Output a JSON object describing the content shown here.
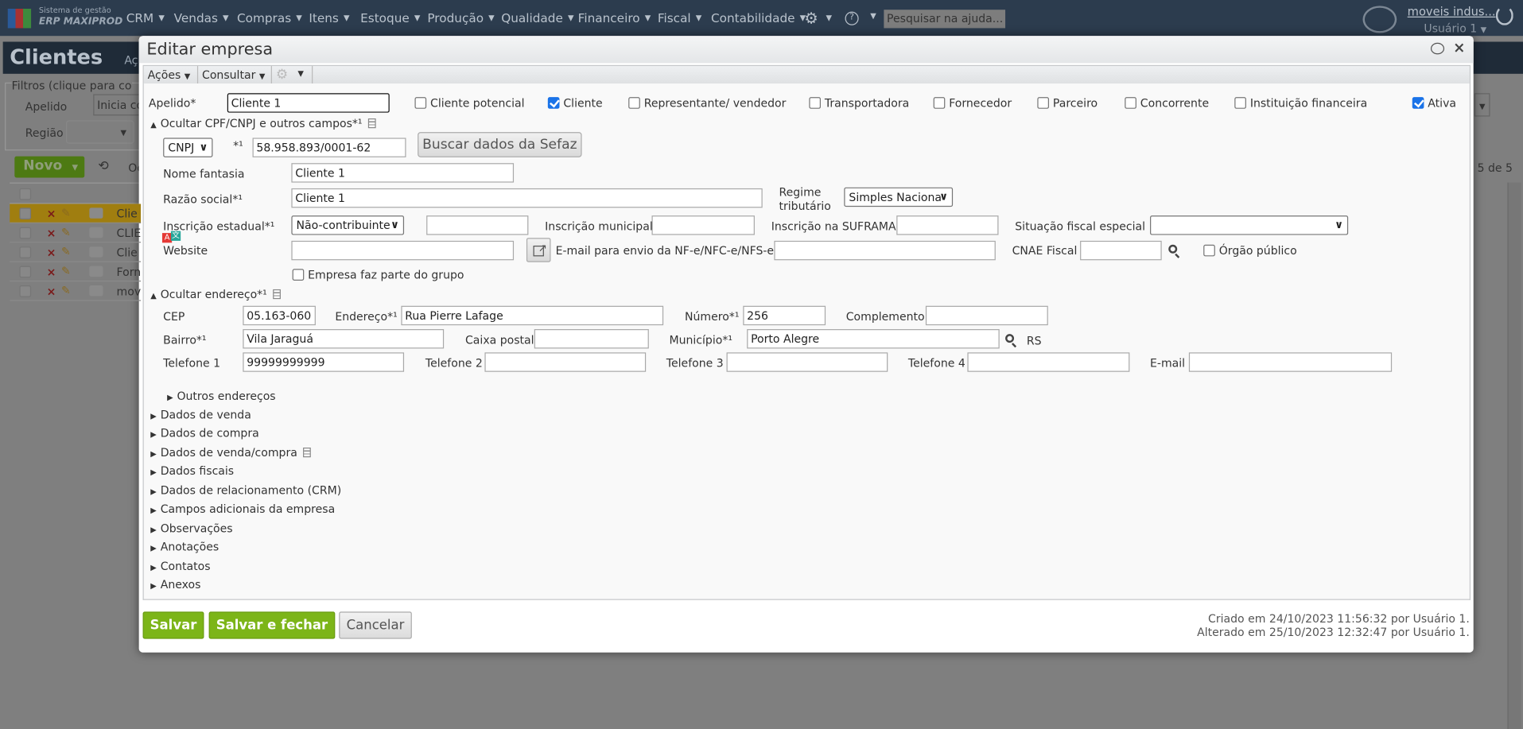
{
  "app": {
    "logo_line1": "Sistema de gestão",
    "logo_line2": "ERP MAXIPROD",
    "nav": [
      "CRM",
      "Vendas",
      "Compras",
      "Itens",
      "Estoque",
      "Produção",
      "Qualidade",
      "Financeiro",
      "Fiscal",
      "Contabilidade"
    ],
    "help_search_placeholder": "Pesquisar na ajuda...",
    "company": "moveis indus...",
    "user": "Usuário 1"
  },
  "background": {
    "page_title": "Clientes",
    "page_title_cut": "Aç",
    "filters_label": "Filtros (clique para co",
    "apelido_label": "Apelido",
    "apelido_value": "Inicia co",
    "regiao_label": "Região",
    "novo_label": "Novo",
    "order_cut": "Oc",
    "count": "5 de 5",
    "rows": [
      "Clie",
      "CLIE",
      "Clie",
      "Forn",
      "mov"
    ]
  },
  "modal": {
    "title": "Editar empresa",
    "toolbar": {
      "acoes": "Ações",
      "consultar": "Consultar"
    },
    "apelido_label": "Apelido*",
    "apelido": "Cliente 1",
    "checkboxes": [
      {
        "label": "Cliente potencial",
        "checked": false
      },
      {
        "label": "Cliente",
        "checked": true
      },
      {
        "label": "Representante/ vendedor",
        "checked": false
      },
      {
        "label": "Transportadora",
        "checked": false
      },
      {
        "label": "Fornecedor",
        "checked": false
      },
      {
        "label": "Parceiro",
        "checked": false
      },
      {
        "label": "Concorrente",
        "checked": false
      },
      {
        "label": "Instituição financeira",
        "checked": false
      },
      {
        "label": "Ativa",
        "checked": true
      }
    ],
    "sec_cpf": "Ocultar CPF/CNPJ e outros campos*¹",
    "doc_type": "CNPJ",
    "req_mark": "*¹",
    "cnpj": "58.958.893/0001-62",
    "buscar": "Buscar dados da Sefaz",
    "nome_fantasia_label": "Nome fantasia",
    "nome_fantasia": "Cliente 1",
    "razao_label": "Razão social*¹",
    "razao": "Cliente 1",
    "regime_label_1": "Regime",
    "regime_label_2": "tributário",
    "regime": "Simples Naciona",
    "ie_label": "Inscrição estadual*¹",
    "ie_select": "Não-contribuinte",
    "ie_value": "",
    "im_label": "Inscrição municipal",
    "im_value": "",
    "suframa_label": "Inscrição na SUFRAMA",
    "suframa_value": "",
    "sit_fiscal_label": "Situação fiscal especial",
    "sit_fiscal": "",
    "website_label": "Website",
    "website": "",
    "email_nfe_label": "E-mail para envio da NF-e/NFC-e/NFS-e",
    "email_nfe": "",
    "cnae_label": "CNAE Fiscal",
    "cnae": "",
    "orgao_publico": "Órgão público",
    "grupo": "Empresa faz parte do grupo",
    "sec_endereco": "Ocultar endereço*¹",
    "cep_label": "CEP",
    "cep": "05.163-060",
    "endereco_label": "Endereço*¹",
    "endereco": "Rua Pierre Lafage",
    "numero_label": "Número*¹",
    "numero": "256",
    "complemento_label": "Complemento",
    "complemento": "",
    "bairro_label": "Bairro*¹",
    "bairro": "Vila Jaraguá",
    "caixa_label": "Caixa postal",
    "caixa": "",
    "municipio_label": "Município*¹",
    "municipio": "Porto Alegre",
    "uf": "RS",
    "tel1_label": "Telefone 1",
    "tel1": "99999999999",
    "tel2_label": "Telefone 2",
    "tel2": "",
    "tel3_label": "Telefone 3",
    "tel3": "",
    "tel4_label": "Telefone 4",
    "tel4": "",
    "email_label": "E-mail",
    "email": "",
    "outros_enderecos": "Outros endereços",
    "sections": [
      "Dados de venda",
      "Dados de compra",
      "Dados de venda/compra",
      "Dados fiscais",
      "Dados de relacionamento (CRM)",
      "Campos adicionais da empresa",
      "Observações",
      "Anotações",
      "Contatos",
      "Anexos"
    ],
    "salvar": "Salvar",
    "salvar_fechar": "Salvar e fechar",
    "cancelar": "Cancelar",
    "criado": "Criado em 24/10/2023 11:56:32 por Usuário 1.",
    "alterado": "Alterado em 25/10/2023 12:32:47 por Usuário 1."
  }
}
